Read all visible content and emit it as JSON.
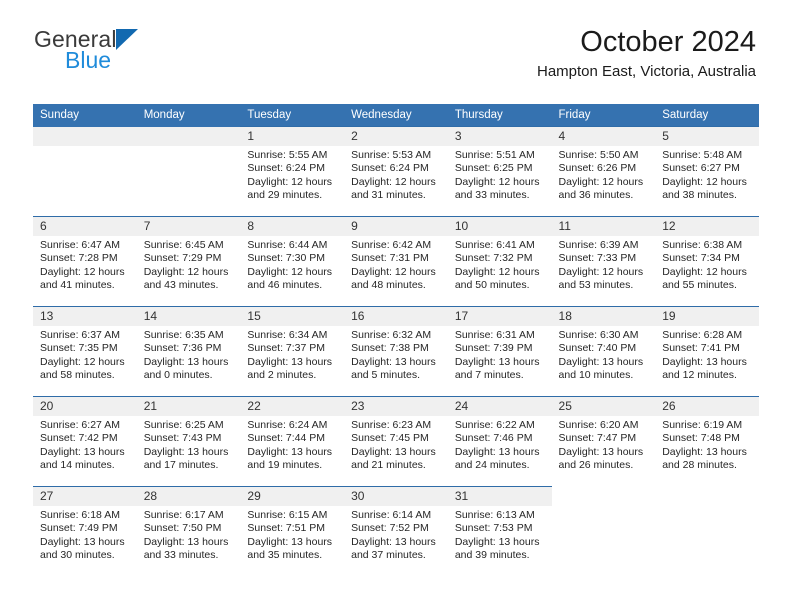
{
  "brand": {
    "name_top": "General",
    "name_bottom": "Blue",
    "triangle_color": "#1269b0",
    "blue_text_color": "#1f8bda"
  },
  "header": {
    "title": "October 2024",
    "location": "Hampton East, Victoria, Australia"
  },
  "theme": {
    "header_blue": "#3572b0",
    "row_divider_blue": "#2f6ca8",
    "daynum_band": "#f0f0f0"
  },
  "weekdays": [
    "Sunday",
    "Monday",
    "Tuesday",
    "Wednesday",
    "Thursday",
    "Friday",
    "Saturday"
  ],
  "labels": {
    "sunrise_prefix": "Sunrise:",
    "sunset_prefix": "Sunset:",
    "daylight_prefix": "Daylight:"
  },
  "weeks": [
    [
      {
        "blank": true
      },
      {
        "blank": true
      },
      {
        "day": "1",
        "sunrise": "Sunrise: 5:55 AM",
        "sunset": "Sunset: 6:24 PM",
        "daylight": "Daylight: 12 hours and 29 minutes."
      },
      {
        "day": "2",
        "sunrise": "Sunrise: 5:53 AM",
        "sunset": "Sunset: 6:24 PM",
        "daylight": "Daylight: 12 hours and 31 minutes."
      },
      {
        "day": "3",
        "sunrise": "Sunrise: 5:51 AM",
        "sunset": "Sunset: 6:25 PM",
        "daylight": "Daylight: 12 hours and 33 minutes."
      },
      {
        "day": "4",
        "sunrise": "Sunrise: 5:50 AM",
        "sunset": "Sunset: 6:26 PM",
        "daylight": "Daylight: 12 hours and 36 minutes."
      },
      {
        "day": "5",
        "sunrise": "Sunrise: 5:48 AM",
        "sunset": "Sunset: 6:27 PM",
        "daylight": "Daylight: 12 hours and 38 minutes."
      }
    ],
    [
      {
        "day": "6",
        "sunrise": "Sunrise: 6:47 AM",
        "sunset": "Sunset: 7:28 PM",
        "daylight": "Daylight: 12 hours and 41 minutes."
      },
      {
        "day": "7",
        "sunrise": "Sunrise: 6:45 AM",
        "sunset": "Sunset: 7:29 PM",
        "daylight": "Daylight: 12 hours and 43 minutes."
      },
      {
        "day": "8",
        "sunrise": "Sunrise: 6:44 AM",
        "sunset": "Sunset: 7:30 PM",
        "daylight": "Daylight: 12 hours and 46 minutes."
      },
      {
        "day": "9",
        "sunrise": "Sunrise: 6:42 AM",
        "sunset": "Sunset: 7:31 PM",
        "daylight": "Daylight: 12 hours and 48 minutes."
      },
      {
        "day": "10",
        "sunrise": "Sunrise: 6:41 AM",
        "sunset": "Sunset: 7:32 PM",
        "daylight": "Daylight: 12 hours and 50 minutes."
      },
      {
        "day": "11",
        "sunrise": "Sunrise: 6:39 AM",
        "sunset": "Sunset: 7:33 PM",
        "daylight": "Daylight: 12 hours and 53 minutes."
      },
      {
        "day": "12",
        "sunrise": "Sunrise: 6:38 AM",
        "sunset": "Sunset: 7:34 PM",
        "daylight": "Daylight: 12 hours and 55 minutes."
      }
    ],
    [
      {
        "day": "13",
        "sunrise": "Sunrise: 6:37 AM",
        "sunset": "Sunset: 7:35 PM",
        "daylight": "Daylight: 12 hours and 58 minutes."
      },
      {
        "day": "14",
        "sunrise": "Sunrise: 6:35 AM",
        "sunset": "Sunset: 7:36 PM",
        "daylight": "Daylight: 13 hours and 0 minutes."
      },
      {
        "day": "15",
        "sunrise": "Sunrise: 6:34 AM",
        "sunset": "Sunset: 7:37 PM",
        "daylight": "Daylight: 13 hours and 2 minutes."
      },
      {
        "day": "16",
        "sunrise": "Sunrise: 6:32 AM",
        "sunset": "Sunset: 7:38 PM",
        "daylight": "Daylight: 13 hours and 5 minutes."
      },
      {
        "day": "17",
        "sunrise": "Sunrise: 6:31 AM",
        "sunset": "Sunset: 7:39 PM",
        "daylight": "Daylight: 13 hours and 7 minutes."
      },
      {
        "day": "18",
        "sunrise": "Sunrise: 6:30 AM",
        "sunset": "Sunset: 7:40 PM",
        "daylight": "Daylight: 13 hours and 10 minutes."
      },
      {
        "day": "19",
        "sunrise": "Sunrise: 6:28 AM",
        "sunset": "Sunset: 7:41 PM",
        "daylight": "Daylight: 13 hours and 12 minutes."
      }
    ],
    [
      {
        "day": "20",
        "sunrise": "Sunrise: 6:27 AM",
        "sunset": "Sunset: 7:42 PM",
        "daylight": "Daylight: 13 hours and 14 minutes."
      },
      {
        "day": "21",
        "sunrise": "Sunrise: 6:25 AM",
        "sunset": "Sunset: 7:43 PM",
        "daylight": "Daylight: 13 hours and 17 minutes."
      },
      {
        "day": "22",
        "sunrise": "Sunrise: 6:24 AM",
        "sunset": "Sunset: 7:44 PM",
        "daylight": "Daylight: 13 hours and 19 minutes."
      },
      {
        "day": "23",
        "sunrise": "Sunrise: 6:23 AM",
        "sunset": "Sunset: 7:45 PM",
        "daylight": "Daylight: 13 hours and 21 minutes."
      },
      {
        "day": "24",
        "sunrise": "Sunrise: 6:22 AM",
        "sunset": "Sunset: 7:46 PM",
        "daylight": "Daylight: 13 hours and 24 minutes."
      },
      {
        "day": "25",
        "sunrise": "Sunrise: 6:20 AM",
        "sunset": "Sunset: 7:47 PM",
        "daylight": "Daylight: 13 hours and 26 minutes."
      },
      {
        "day": "26",
        "sunrise": "Sunrise: 6:19 AM",
        "sunset": "Sunset: 7:48 PM",
        "daylight": "Daylight: 13 hours and 28 minutes."
      }
    ],
    [
      {
        "day": "27",
        "sunrise": "Sunrise: 6:18 AM",
        "sunset": "Sunset: 7:49 PM",
        "daylight": "Daylight: 13 hours and 30 minutes."
      },
      {
        "day": "28",
        "sunrise": "Sunrise: 6:17 AM",
        "sunset": "Sunset: 7:50 PM",
        "daylight": "Daylight: 13 hours and 33 minutes."
      },
      {
        "day": "29",
        "sunrise": "Sunrise: 6:15 AM",
        "sunset": "Sunset: 7:51 PM",
        "daylight": "Daylight: 13 hours and 35 minutes."
      },
      {
        "day": "30",
        "sunrise": "Sunrise: 6:14 AM",
        "sunset": "Sunset: 7:52 PM",
        "daylight": "Daylight: 13 hours and 37 minutes."
      },
      {
        "day": "31",
        "sunrise": "Sunrise: 6:13 AM",
        "sunset": "Sunset: 7:53 PM",
        "daylight": "Daylight: 13 hours and 39 minutes."
      },
      {
        "trailing": true
      },
      {
        "trailing": true
      }
    ]
  ]
}
